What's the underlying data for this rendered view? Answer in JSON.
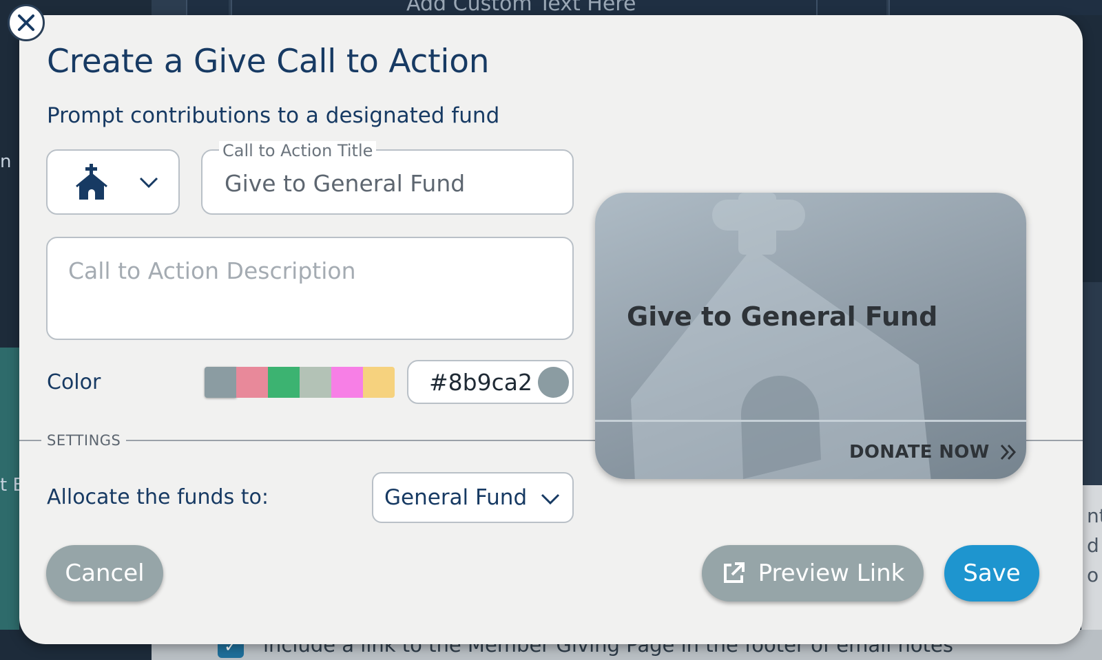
{
  "background": {
    "top_text": "Add Custom Text Here",
    "bottom_text": "include a link to the Member Giving Page in the footer of email notes",
    "left_letters": [
      "n",
      "t B"
    ],
    "right_letters": [
      "nt",
      "d",
      "o"
    ]
  },
  "modal": {
    "title": "Create a Give Call to Action",
    "subtitle": "Prompt contributions to a designated fund",
    "icon_select": {
      "icon": "church-icon"
    },
    "cta_title": {
      "legend": "Call to Action Title",
      "value": "Give to General Fund"
    },
    "cta_description": {
      "placeholder": "Call to Action Description",
      "value": ""
    },
    "color": {
      "label": "Color",
      "swatches": [
        "#8b9ca2",
        "#e8899a",
        "#3cb371",
        "#b3c2b6",
        "#f77fe6",
        "#f6d27e"
      ],
      "hex_value": "#8b9ca2"
    },
    "settings_label": "SETTINGS",
    "allocate": {
      "label": "Allocate the funds to:",
      "value": "General Fund"
    },
    "preview_card": {
      "title": "Give to General Fund",
      "action": "DONATE NOW"
    },
    "buttons": {
      "cancel": "Cancel",
      "preview_link": "Preview Link",
      "save": "Save"
    }
  },
  "colors": {
    "heading": "#173a63",
    "primary_button": "#1e95cf",
    "secondary_button": "#96a5a8"
  }
}
